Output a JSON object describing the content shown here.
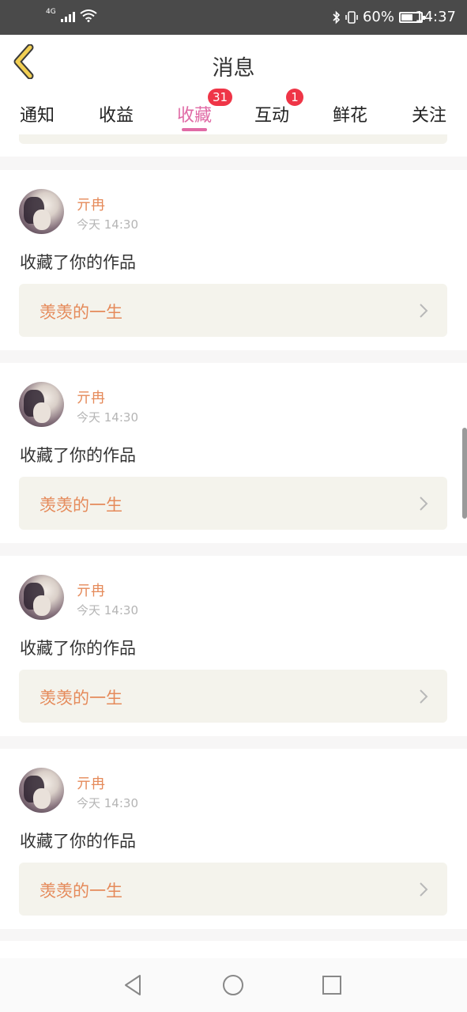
{
  "status_bar": {
    "network": "4G",
    "battery": "60%",
    "battery_level": 0.6,
    "time": "14:37"
  },
  "header": {
    "title": "消息",
    "back_icon": "chevron-left-icon"
  },
  "tabs": [
    {
      "label": "通知",
      "badge": ""
    },
    {
      "label": "收益",
      "badge": ""
    },
    {
      "label": "收藏",
      "badge": "31",
      "active": true
    },
    {
      "label": "互动",
      "badge": "1"
    },
    {
      "label": "鲜花",
      "badge": ""
    },
    {
      "label": "关注",
      "badge": ""
    }
  ],
  "colors": {
    "accent": "#e06ba6",
    "badge": "#ef3547",
    "name": "#e58a5a"
  },
  "items": [
    {
      "user": "亓冉",
      "time": "今天 14:30",
      "action": "收藏了你的作品",
      "work": "羡羡的一生"
    },
    {
      "user": "亓冉",
      "time": "今天 14:30",
      "action": "收藏了你的作品",
      "work": "羡羡的一生"
    },
    {
      "user": "亓冉",
      "time": "今天 14:30",
      "action": "收藏了你的作品",
      "work": "羡羡的一生"
    },
    {
      "user": "亓冉",
      "time": "今天 14:30",
      "action": "收藏了你的作品",
      "work": "羡羡的一生"
    }
  ],
  "system_nav": [
    "back-triangle-icon",
    "home-circle-icon",
    "recents-square-icon"
  ]
}
